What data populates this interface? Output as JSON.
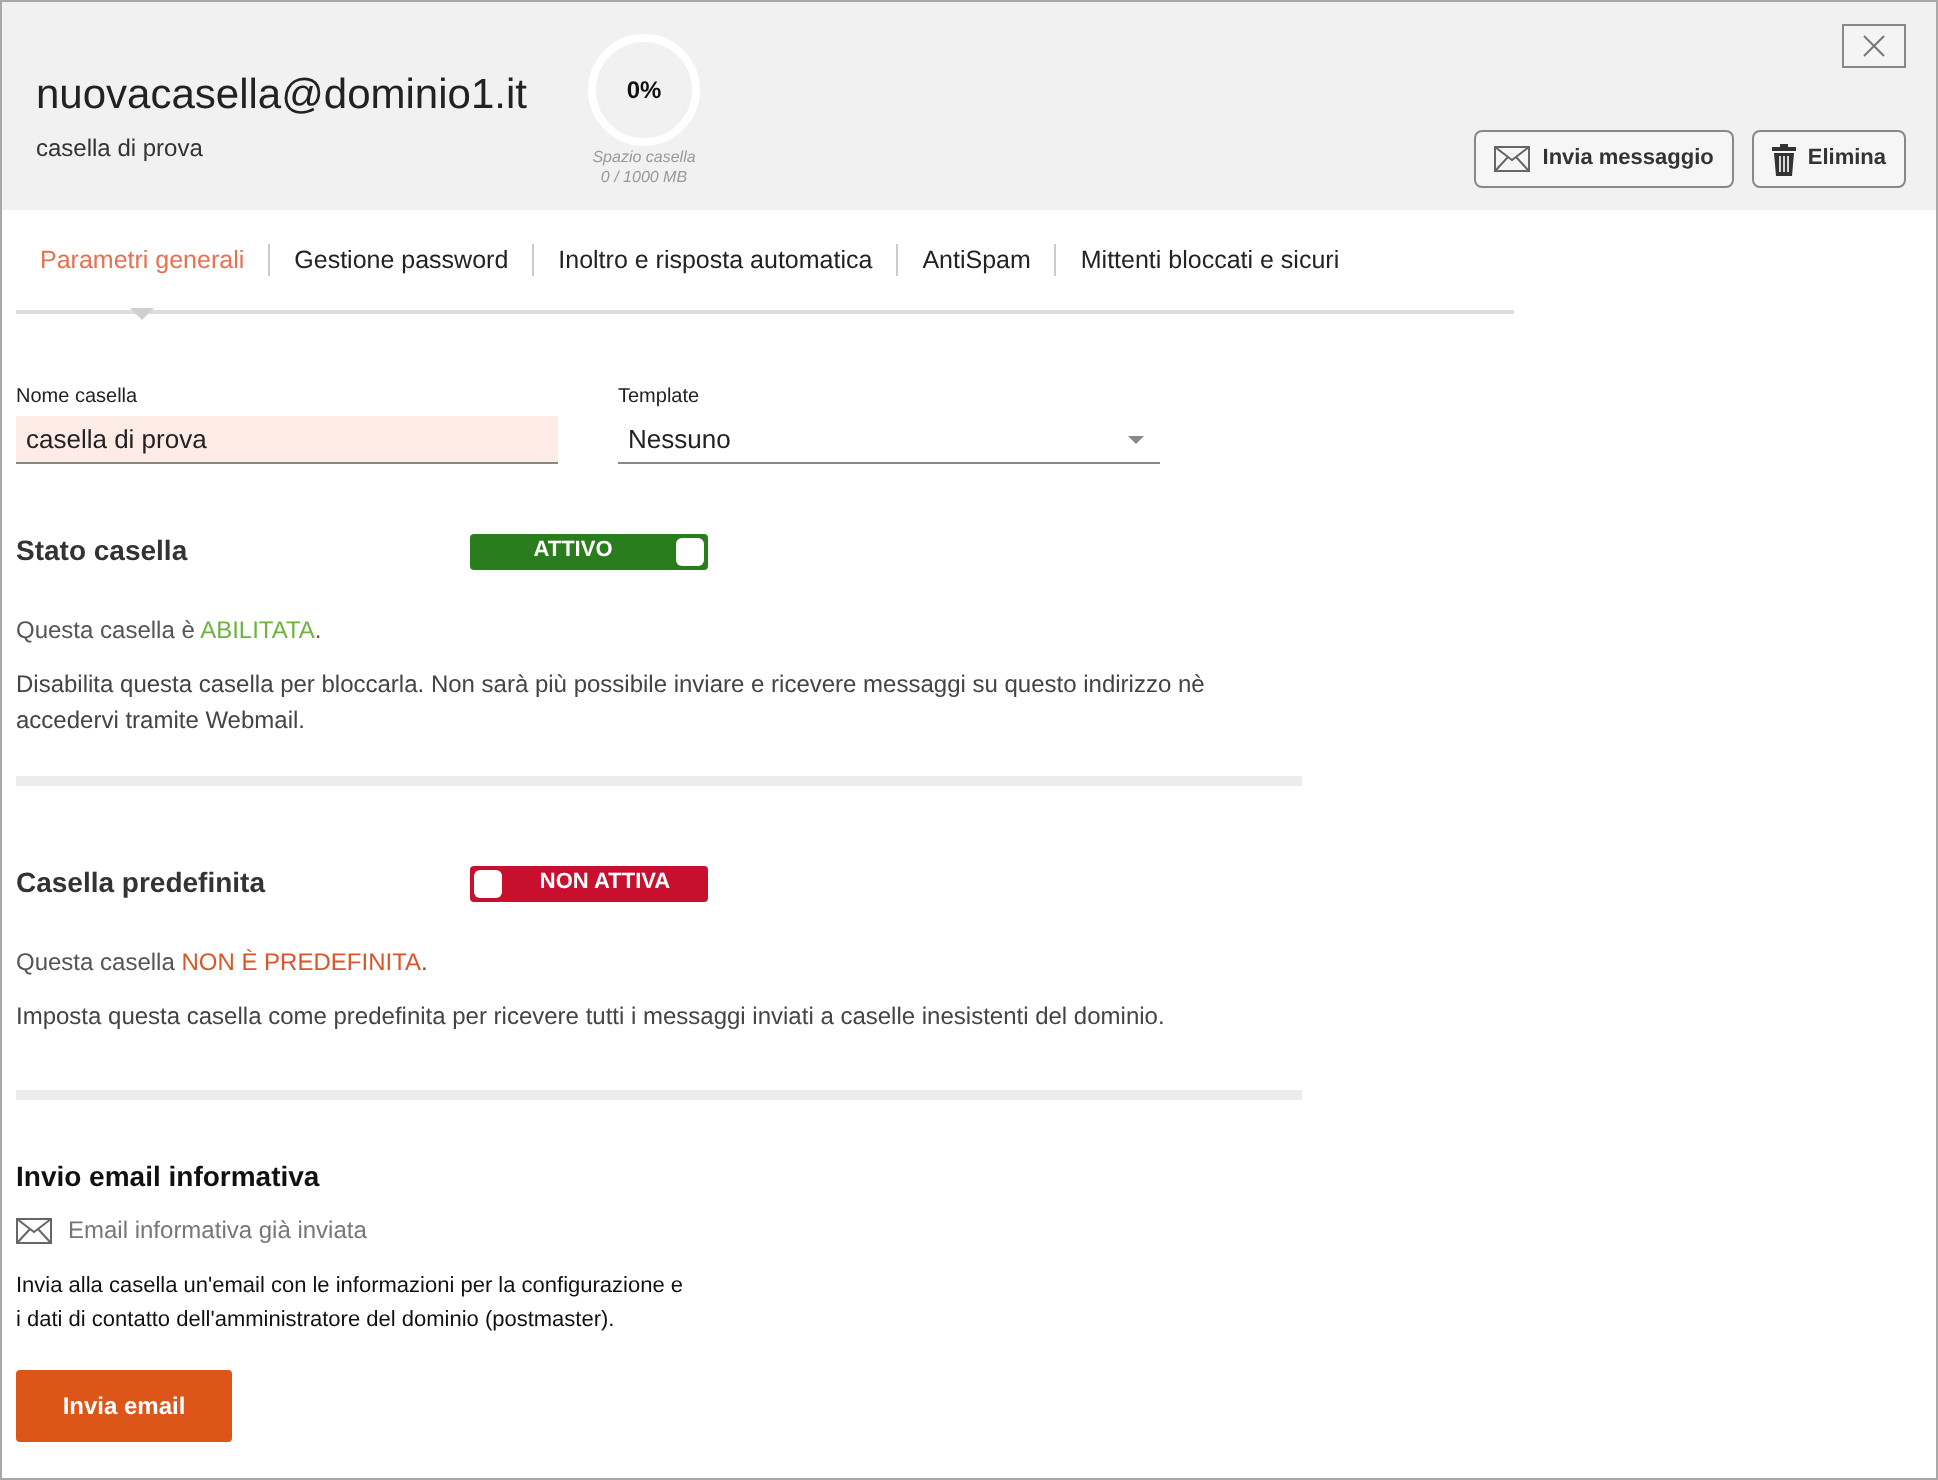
{
  "header": {
    "title": "nuovacasella@dominio1.it",
    "subtitle": "casella di prova",
    "usage": {
      "percent": "0%",
      "label": "Spazio casella",
      "amount": "0 / 1000 MB"
    },
    "buttons": [
      {
        "kind": "mail",
        "label": "Invia messaggio"
      },
      {
        "kind": "trash",
        "label": "Elimina"
      }
    ]
  },
  "tabs": [
    {
      "label": "Parametri generali",
      "selected": true
    },
    {
      "label": "Gestione password",
      "selected": false
    },
    {
      "label": "Inoltro e risposta automatica",
      "selected": false
    },
    {
      "label": "AntiSpam",
      "selected": false
    },
    {
      "label": "Mittenti bloccati e sicuri",
      "selected": false
    }
  ],
  "fields": [
    {
      "kind": "text",
      "label": "Nome casella",
      "value": "casella di prova"
    },
    {
      "kind": "select",
      "label": "Template",
      "value": "Nessuno"
    }
  ],
  "settings": [
    {
      "title": "Stato casella",
      "on": true,
      "toggle_label": "ATTIVO",
      "status_before": "Questa casella è ",
      "status_highlight": "ABILITATA",
      "status_after": ".",
      "description": "Disabilita questa casella per bloccarla. Non sarà più possibile inviare e ricevere messaggi su questo indirizzo nè accedervi tramite Webmail."
    },
    {
      "title": "Casella predefinita",
      "on": false,
      "toggle_label": "NON ATTIVA",
      "status_before": "Questa casella ",
      "status_highlight": "NON È PREDEFINITA",
      "status_after": ".",
      "description": "Imposta questa casella come predefinita per ricevere tutti i messaggi inviati a caselle inesistenti del dominio."
    }
  ],
  "info_email": {
    "title": "Invio email informativa",
    "sent_note": "Email informativa già inviata",
    "description_lines": [
      "Invia alla casella un'email con le informazioni per la configurazione e",
      "i dati di contatto dell'amministratore del dominio (postmaster)."
    ],
    "button": "Invia email"
  }
}
